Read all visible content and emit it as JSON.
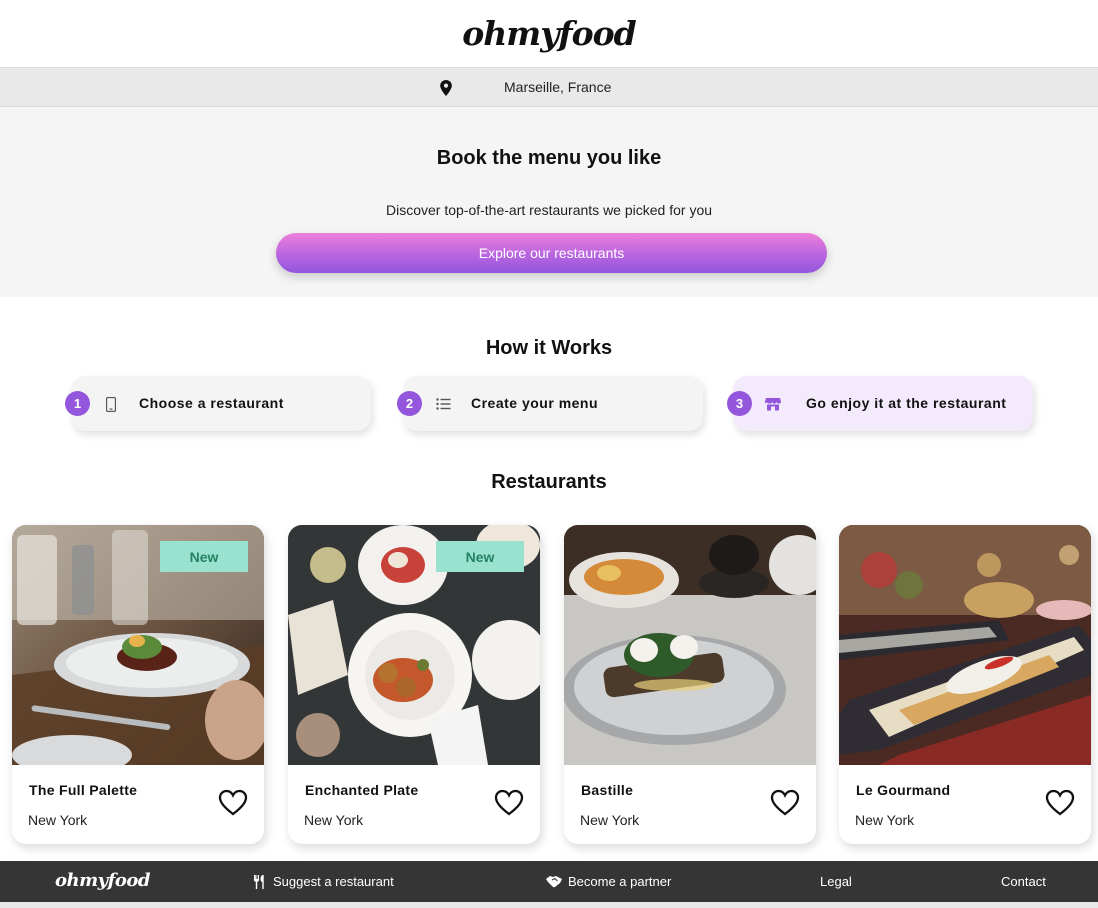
{
  "header": {
    "logo": "ohmyfood"
  },
  "location": {
    "icon": "map-pin-icon",
    "text": "Marseille, France"
  },
  "hero": {
    "title": "Book the menu you like",
    "subtitle": "Discover top-of-the-art restaurants we picked for you",
    "cta_label": "Explore our restaurants",
    "cta_gradient": [
      "#ee7fd9",
      "#9356dc"
    ]
  },
  "how_it_works": {
    "title": "How it Works",
    "steps": [
      {
        "number": "1",
        "icon": "mobile-phone-icon",
        "label": "Choose a restaurant"
      },
      {
        "number": "2",
        "icon": "list-icon",
        "label": "Create your menu"
      },
      {
        "number": "3",
        "icon": "store-icon",
        "label": "Go enjoy it at the restaurant"
      }
    ],
    "accent_color": "#9356dc"
  },
  "restaurants": {
    "title": "Restaurants",
    "items": [
      {
        "name": "The Full Palette",
        "city": "New York",
        "badge": "New"
      },
      {
        "name": "Enchanted Plate",
        "city": "New York",
        "badge": "New"
      },
      {
        "name": "Bastille",
        "city": "New York",
        "badge": ""
      },
      {
        "name": "Le Gourmand",
        "city": "New York",
        "badge": ""
      }
    ],
    "badge_color": "#99e2d0"
  },
  "footer": {
    "logo": "ohmyfood",
    "links": [
      {
        "icon": "utensils-icon",
        "label": "Suggest a restaurant"
      },
      {
        "icon": "handshake-icon",
        "label": "Become a partner"
      },
      {
        "icon": "",
        "label": "Legal"
      },
      {
        "icon": "",
        "label": "Contact"
      }
    ],
    "background": "#353535"
  }
}
